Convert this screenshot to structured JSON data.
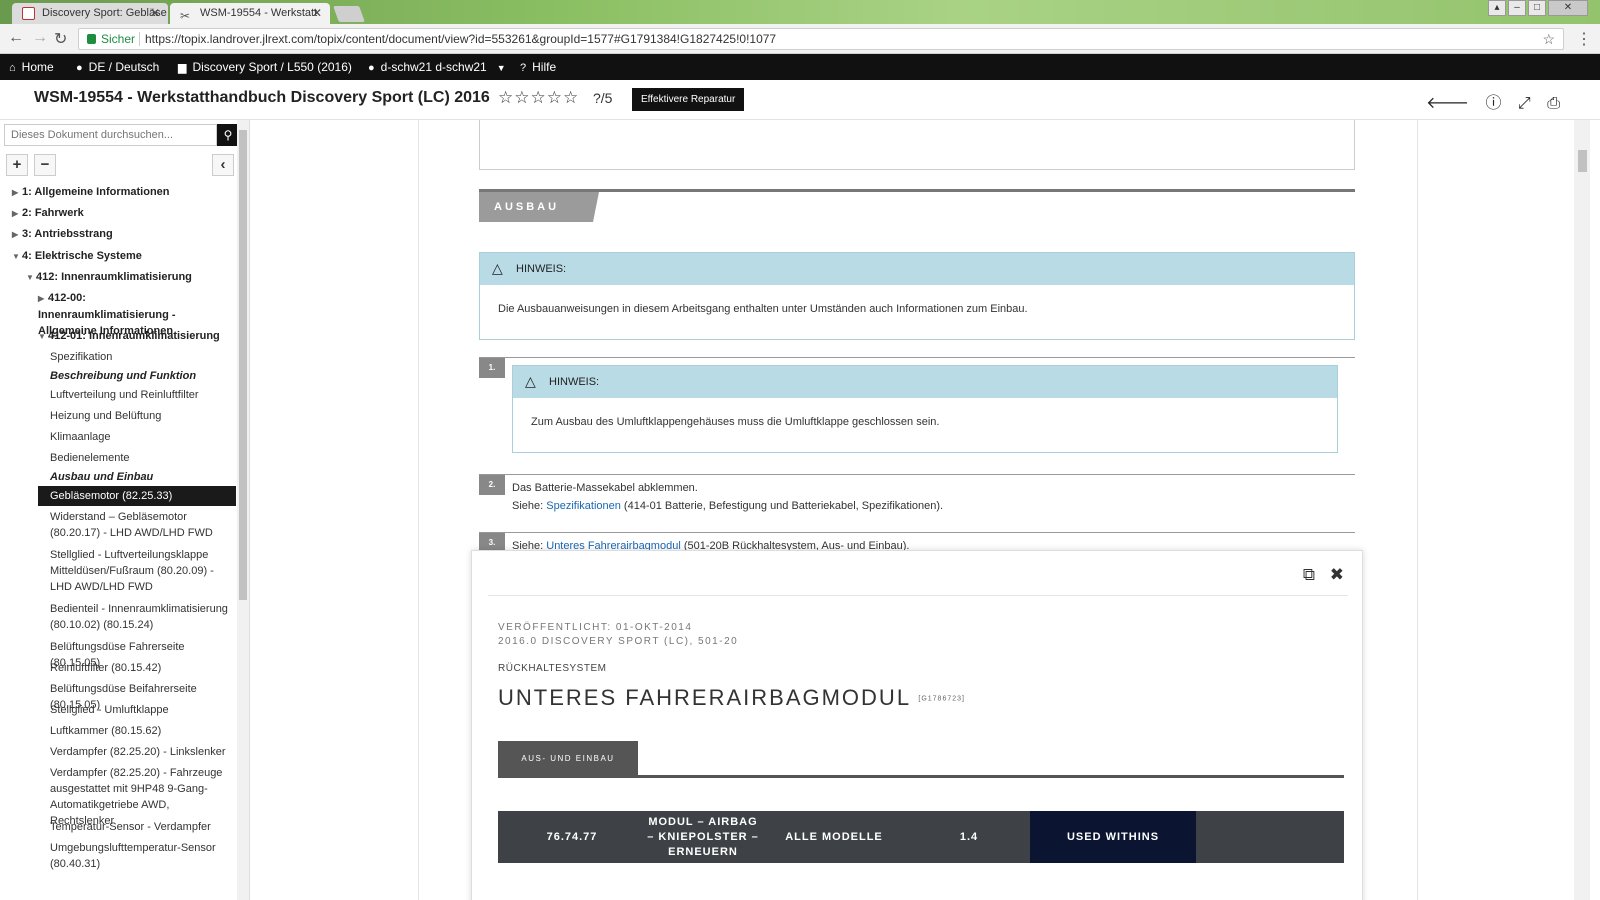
{
  "browser": {
    "tabs": [
      {
        "label": "Discovery Sport: Gebläse"
      },
      {
        "label": "WSM-19554 - Werkstatt"
      }
    ],
    "secure_label": "Sicher",
    "url": "https://topix.landrover.jlrext.com/topix/content/document/view?id=553261&groupId=1577#G1791384!G1827425!0!1077"
  },
  "topnav": {
    "home": "Home",
    "language": "DE / Deutsch",
    "vehicle": "Discovery Sport / L550 (2016)",
    "user": "d-schw21 d-schw21",
    "help": "Hilfe"
  },
  "titlebar": {
    "title": "WSM-19554 - Werkstatthandbuch Discovery Sport (LC) 2016",
    "stars": "☆☆☆☆☆",
    "rating": "?/5",
    "button": "Effektivere Reparatur"
  },
  "sidebar": {
    "search_placeholder": "Dieses Dokument durchsuchen...",
    "tree": [
      {
        "label": "1: Allgemeine Informationen"
      },
      {
        "label": "2: Fahrwerk"
      },
      {
        "label": "3: Antriebsstrang"
      },
      {
        "label": "4: Elektrische Systeme"
      },
      {
        "label": "412: Innenraumklimatisierung"
      },
      {
        "label": "412-00: Innenraumklimatisierung - Allgemeine Informationen"
      },
      {
        "label": "412-01: Innenraumklimatisierung"
      },
      {
        "label": "Spezifikation"
      },
      {
        "label": "Beschreibung und Funktion"
      },
      {
        "label": "Luftverteilung und Reinluftfilter"
      },
      {
        "label": "Heizung und Belüftung"
      },
      {
        "label": "Klimaanlage"
      },
      {
        "label": "Bedienelemente"
      },
      {
        "label": "Ausbau und Einbau"
      },
      {
        "label": "Gebläsemotor (82.25.33)"
      },
      {
        "label": "Widerstand – Gebläsemotor (80.20.17) - LHD AWD/LHD FWD"
      },
      {
        "label": "Stellglied - Luftverteilungsklappe Mitteldüsen/Fußraum (80.20.09) - LHD AWD/LHD FWD"
      },
      {
        "label": "Bedienteil - Innenraumklimatisierung (80.10.02) (80.15.24)"
      },
      {
        "label": "Belüftungsdüse Fahrerseite (80.15.05)"
      },
      {
        "label": "Reinluftfilter (80.15.42)"
      },
      {
        "label": "Belüftungsdüse Beifahrerseite (80.15.05)"
      },
      {
        "label": "Stellglied - Umluftklappe"
      },
      {
        "label": "Luftkammer (80.15.62)"
      },
      {
        "label": "Verdampfer (82.25.20) - Linkslenker"
      },
      {
        "label": "Verdampfer (82.25.20) - Fahrzeuge ausgestattet mit 9HP48 9-Gang-Automatikgetriebe AWD, Rechtslenker"
      },
      {
        "label": "Temperatur-Sensor - Verdampfer"
      },
      {
        "label": "Umgebungslufttemperatur-Sensor (80.40.31)"
      }
    ]
  },
  "content": {
    "section": "AUSBAU",
    "note1": {
      "head": "HINWEIS:",
      "body": "Die Ausbauanweisungen in diesem Arbeitsgang enthalten unter Umständen auch Informationen zum Einbau."
    },
    "step1": {
      "num": "1.",
      "note_head": "HINWEIS:",
      "note_body": "Zum Ausbau des Umluftklappengehäuses muss die Umluftklappe geschlossen sein."
    },
    "step2": {
      "num": "2.",
      "text": "Das Batterie-Massekabel abklemmen.",
      "see": "Siehe: ",
      "link": "Spezifikationen",
      "rest": " (414-01 Batterie, Befestigung und Batteriekabel, Spezifikationen)."
    },
    "step3": {
      "num": "3.",
      "see": "Siehe: ",
      "link": "Unteres Fahrerairbagmodul",
      "rest": " (501-20B Rückhaltesystem, Aus- und Einbau)."
    }
  },
  "popup": {
    "published": "VERÖFFENTLICHT: 01-OKT-2014",
    "model": "2016.0 DISCOVERY SPORT (LC), 501-20",
    "category": "RÜCKHALTESYSTEM",
    "title": "UNTERES FAHRERAIRBAGMODUL",
    "code": "[G1786723]",
    "tab": "AUS- UND EINBAU",
    "table": {
      "op": "76.74.77",
      "desc": "MODUL – AIRBAG – KNIEPOLSTER – ERNEUERN",
      "models": "ALLE MODELLE",
      "time": "1.4",
      "withins": "USED WITHINS"
    }
  }
}
